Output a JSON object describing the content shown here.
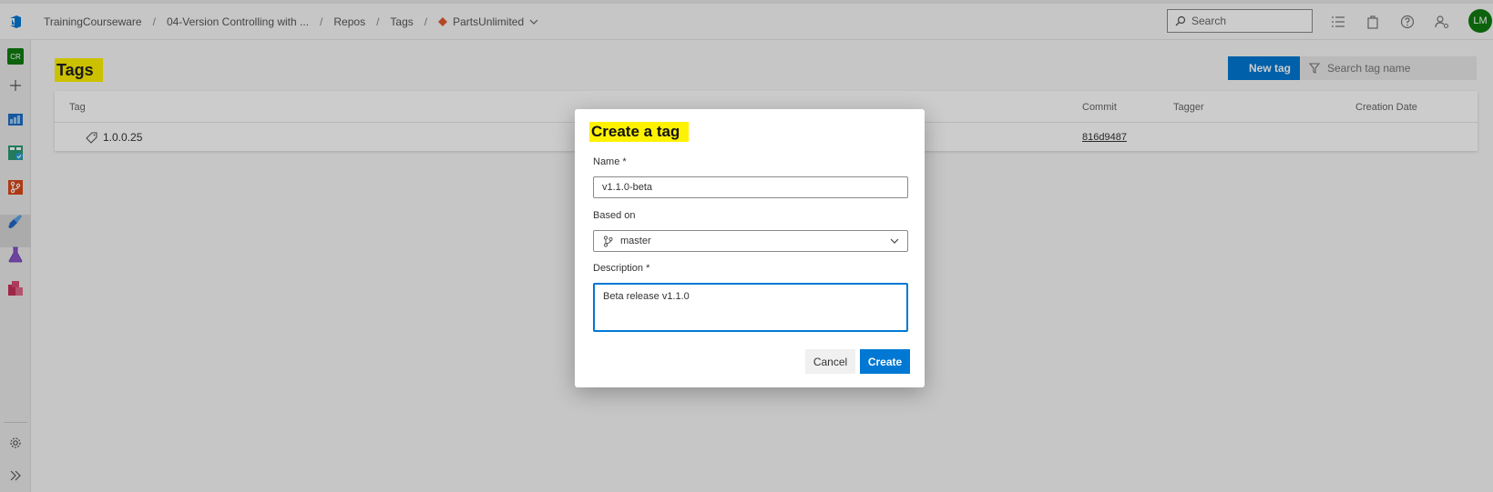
{
  "breadcrumb": {
    "items": [
      "TrainingCourseware",
      "04-Version Controlling with ...",
      "Repos",
      "Tags"
    ],
    "repo": "PartsUnlimited",
    "separator": "/"
  },
  "header": {
    "search_placeholder": "Search",
    "avatar_initials": "LM",
    "accent_color": "#0078d4",
    "avatar_color": "#107c10"
  },
  "rail": {
    "project_badge": "CR"
  },
  "page": {
    "title": "Tags",
    "new_tag_label": "New tag",
    "filter_placeholder": "Search tag name"
  },
  "table": {
    "columns": [
      "Tag",
      "Commit",
      "Tagger",
      "Creation Date"
    ],
    "rows": [
      {
        "tag": "1.0.0.25",
        "commit": "816d9487",
        "tagger": "",
        "date": ""
      }
    ]
  },
  "dialog": {
    "title": "Create a tag",
    "name_label": "Name *",
    "name_value": "v1.1.0-beta",
    "based_on_label": "Based on",
    "based_on_value": "master",
    "description_label": "Description *",
    "description_value": "Beta release v1.1.0",
    "cancel_label": "Cancel",
    "create_label": "Create"
  }
}
